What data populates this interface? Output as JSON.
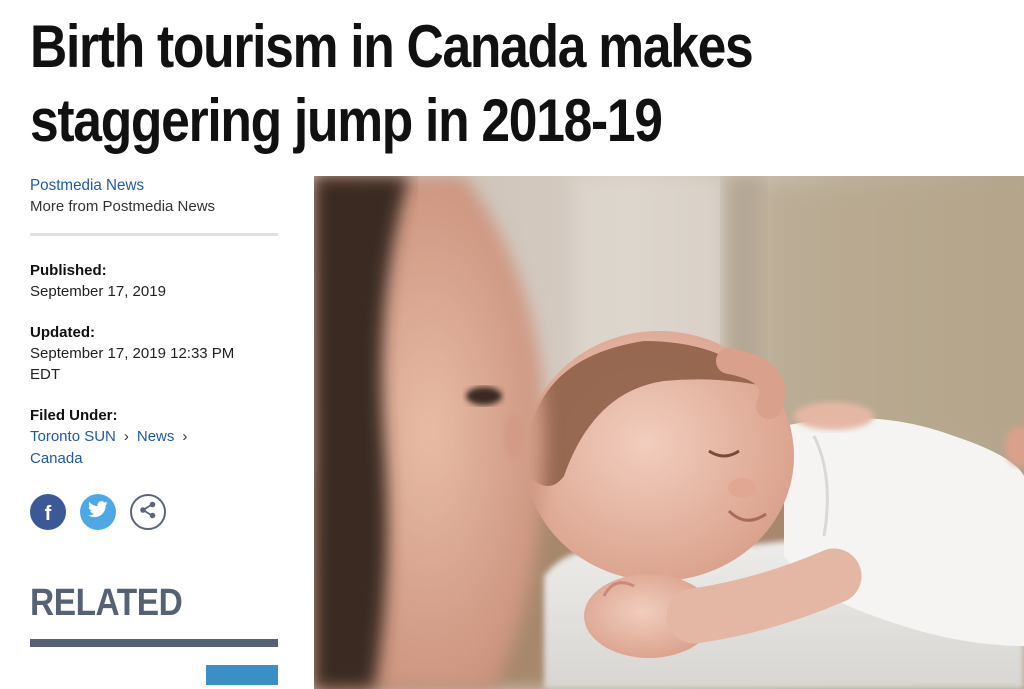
{
  "article": {
    "headline_line1": "Birth tourism in Canada makes",
    "headline_line2": "staggering jump in 2018-19"
  },
  "author": {
    "name": "Postmedia News",
    "more_label": "More from Postmedia News"
  },
  "meta": {
    "published_label": "Published:",
    "published_value": "September 17, 2019",
    "updated_label": "Updated:",
    "updated_value_line1": "September 17, 2019 12:33 PM",
    "updated_value_line2": "EDT",
    "filed_label": "Filed Under:",
    "filed_links": [
      "Toronto SUN",
      "News",
      "Canada"
    ],
    "separator": "›"
  },
  "share": {
    "facebook_glyph": "f",
    "icons": [
      "facebook-icon",
      "twitter-icon",
      "share-icon"
    ],
    "colors": {
      "facebook": "#3b5998",
      "twitter": "#4fa8e6",
      "share_border": "#5a6577"
    }
  },
  "related": {
    "title": "RELATED"
  },
  "colors": {
    "link": "#1f5aa8",
    "headline": "#111111",
    "related": "#566173"
  }
}
